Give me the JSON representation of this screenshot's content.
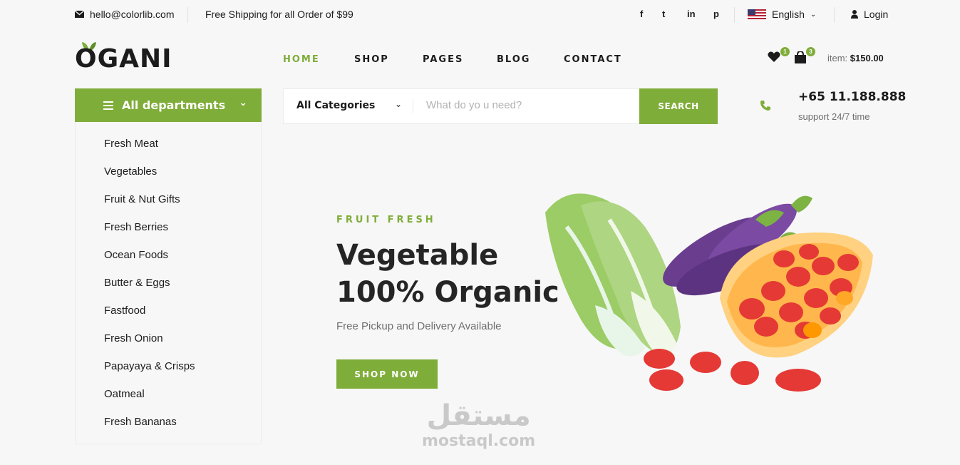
{
  "topbar": {
    "email": "hello@colorlib.com",
    "shipping": "Free Shipping for all Order of $99",
    "social": [
      "f",
      "t",
      "in",
      "p"
    ],
    "language": "English",
    "login": "Login"
  },
  "header": {
    "logo": "OGANI",
    "nav": [
      "HOME",
      "SHOP",
      "PAGES",
      "BLOG",
      "CONTACT"
    ],
    "wishlist_count": "1",
    "cart_count": "3",
    "item_label": "item:",
    "item_total": "$150.00"
  },
  "departments": {
    "title": "All departments",
    "items": [
      "Fresh Meat",
      "Vegetables",
      "Fruit & Nut Gifts",
      "Fresh Berries",
      "Ocean Foods",
      "Butter & Eggs",
      "Fastfood",
      "Fresh Onion",
      "Papayaya & Crisps",
      "Oatmeal",
      "Fresh Bananas"
    ]
  },
  "search": {
    "category": "All Categories",
    "placeholder": "What do yo u need?",
    "button": "SEARCH"
  },
  "contact": {
    "phone": "+65 11.188.888",
    "support": "support 24/7 time"
  },
  "hero": {
    "eyebrow": "FRUIT FRESH",
    "title_line1": "Vegetable",
    "title_line2": "100% Organic",
    "subtitle": "Free Pickup and Delivery Available",
    "button": "SHOP NOW"
  },
  "watermark": {
    "arabic": "مستقل",
    "latin": "mostaql.com"
  },
  "colors": {
    "accent": "#7fad39",
    "text": "#1c1c1c",
    "muted": "#6f6f6f"
  }
}
